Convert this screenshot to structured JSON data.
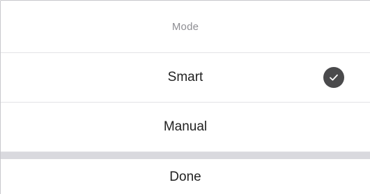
{
  "sheet": {
    "title": "Mode",
    "options": [
      {
        "label": "Smart",
        "selected": true,
        "indicator_icon": "checkmark-circle-icon"
      },
      {
        "label": "Manual",
        "selected": false
      }
    ],
    "done_label": "Done"
  },
  "colors": {
    "title_text": "#8e8e93",
    "option_text": "#222222",
    "check_fill": "#4a4a4c",
    "divider": "#d9d9de"
  }
}
